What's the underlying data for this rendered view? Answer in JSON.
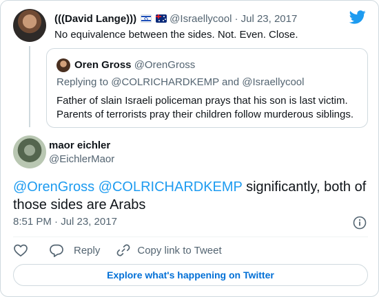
{
  "parent_tweet": {
    "name": "(((David Lange)))",
    "handle": "@Israellycool",
    "date": "· Jul 23, 2017",
    "text": "No equivalence between the sides. Not. Even. Close.",
    "flags": [
      "israel-flag-icon",
      "australia-flag-icon"
    ]
  },
  "quoted_tweet": {
    "name": "Oren Gross",
    "handle": "@OrenGross",
    "replying_to": "Replying to @COLRICHARDKEMP and @Israellycool",
    "text": "Father of slain Israeli policeman prays that his son is last victim. Parents of terrorists pray their children follow murderous siblings."
  },
  "main_tweet": {
    "name": "maor eichler",
    "handle": "@EichlerMaor",
    "mention_1": "@OrenGross",
    "mention_2": "@COLRICHARDKEMP",
    "text_rest": " significantly, both of those sides are Arabs",
    "timestamp": "8:51 PM · Jul 23, 2017"
  },
  "actions": {
    "reply_label": "Reply",
    "copy_link_label": "Copy link to Tweet"
  },
  "explore_label": "Explore what's happening on Twitter",
  "colors": {
    "brand_blue": "#1d9bf0",
    "link_blue": "#006fd6",
    "muted_text": "#536471",
    "border": "#cfd9de"
  }
}
